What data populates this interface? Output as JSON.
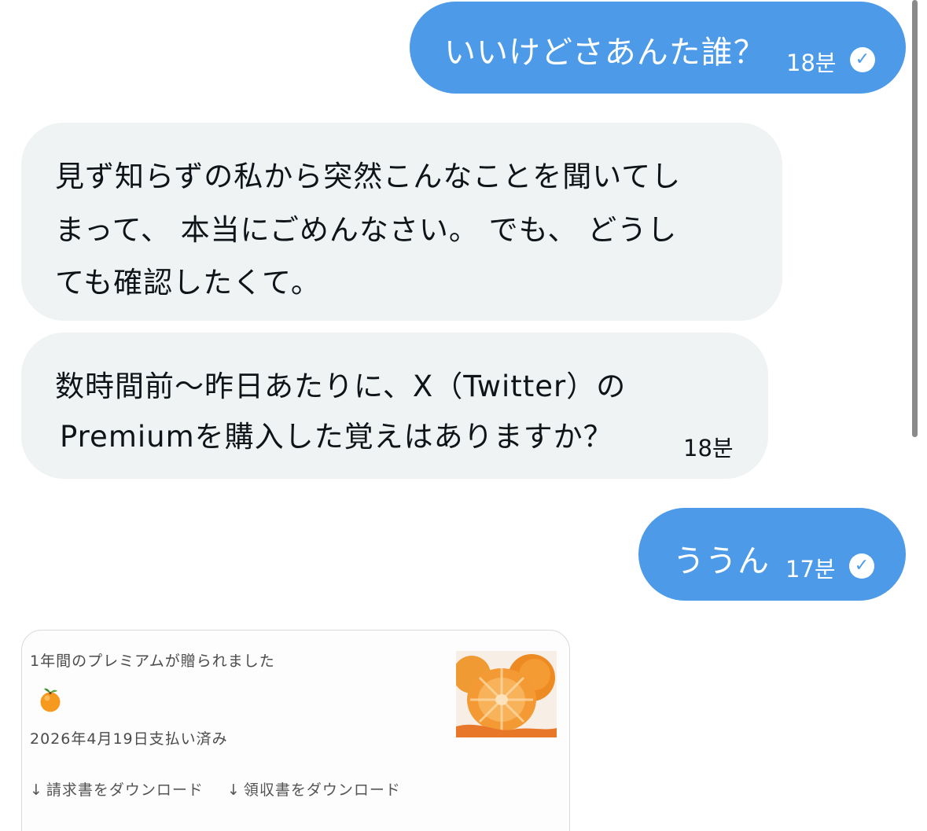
{
  "conversation": {
    "messages": [
      {
        "direction": "outgoing",
        "lines": [
          "いいけどさあんた誰？"
        ],
        "timestamp": "18분",
        "status_icon": "read-check-icon"
      },
      {
        "direction": "incoming",
        "lines": [
          "見ず知らずの私から突然こんなことを聞いてし",
          "まって、 本当にごめんなさい。 でも、 どうし",
          "ても確認したくて。"
        ]
      },
      {
        "direction": "incoming",
        "lines": [
          "数時間前〜昨日あたりに、X（Twitter）の",
          "Premiumを購入した覚えはありますか？"
        ],
        "timestamp": "18분"
      },
      {
        "direction": "outgoing",
        "lines": [
          "ううん"
        ],
        "timestamp": "17분",
        "status_icon": "read-check-icon"
      }
    ],
    "gift_card": {
      "title": "1年間のプレミアムが贈られました",
      "icon": "tangerine-emoji",
      "paid_text": "2026年4月19日支払い済み",
      "links": [
        {
          "icon": "download-arrow-icon",
          "arrow": "↓",
          "label": "請求書をダウンロード"
        },
        {
          "icon": "download-arrow-icon",
          "arrow": "↓",
          "label": "領収書をダウンロード"
        }
      ],
      "image": "peeled-tangerine-photo"
    }
  },
  "colors": {
    "outgoing_bubble": "#4c9ae8",
    "incoming_bubble": "#eff3f4",
    "text_dark": "#0f1419"
  }
}
